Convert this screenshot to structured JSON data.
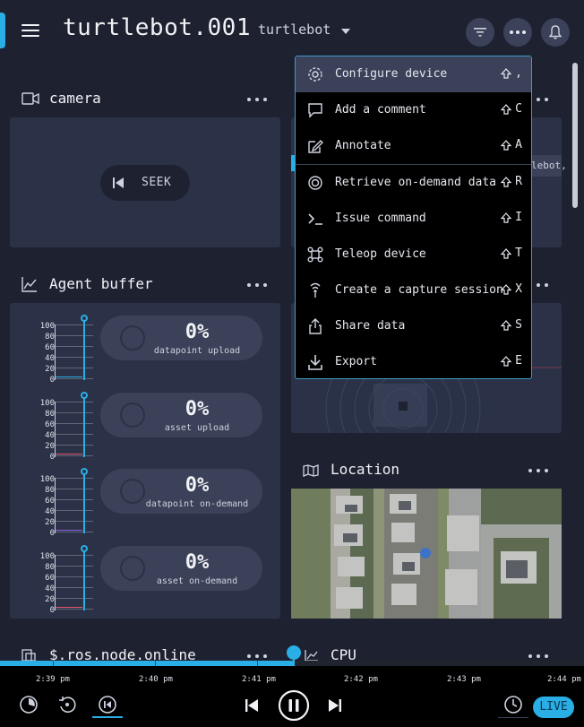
{
  "header": {
    "title": "turtlebot.001",
    "device_select": "turtlebot",
    "icons": [
      "hamburger-icon",
      "filter-icon",
      "more-icon",
      "bell-icon"
    ]
  },
  "panels": {
    "camera": {
      "title": "camera",
      "seek_label": "SEEK"
    },
    "agent_buffer": {
      "title": "Agent buffer",
      "ticks": [
        "100",
        "80",
        "60",
        "40",
        "20",
        "0"
      ],
      "rows": [
        {
          "value": "0%",
          "label": "datapoint upload",
          "line_color": "#29aee6"
        },
        {
          "value": "0%",
          "label": "asset upload",
          "line_color": "#e2566b"
        },
        {
          "value": "0%",
          "label": "datapoint on-demand",
          "line_color": "#8a5bd6"
        },
        {
          "value": "0%",
          "label": "asset on-demand",
          "line_color": "#e2566b"
        }
      ]
    },
    "location": {
      "title": "Location"
    },
    "ros_node": {
      "title": "$.ros.node.online"
    },
    "cpu": {
      "title": "CPU"
    },
    "hidden_text": "lebot,"
  },
  "menu": {
    "items": [
      {
        "label": "Configure device",
        "key": ",",
        "icon": "gear-icon",
        "active": true
      },
      {
        "label": "Add a comment",
        "key": "C",
        "icon": "comment-icon"
      },
      {
        "label": "Annotate",
        "key": "A",
        "icon": "annotate-icon"
      },
      {
        "label": "Retrieve on-demand data",
        "key": "R",
        "icon": "retrieve-icon"
      },
      {
        "label": "Issue command",
        "key": "I",
        "icon": "terminal-icon"
      },
      {
        "label": "Teleop device",
        "key": "T",
        "icon": "teleop-icon"
      },
      {
        "label": "Create a capture session",
        "key": "X",
        "icon": "capture-icon"
      },
      {
        "label": "Share data",
        "key": "S",
        "icon": "share-icon"
      },
      {
        "label": "Export",
        "key": "E",
        "icon": "export-icon"
      }
    ]
  },
  "timeline": {
    "labels": [
      "2:39 pm",
      "2:40 pm",
      "2:41 pm",
      "2:42 pm",
      "2:43 pm",
      "2:44 pm"
    ],
    "live_label": "LIVE",
    "accent": "#29aee6"
  }
}
